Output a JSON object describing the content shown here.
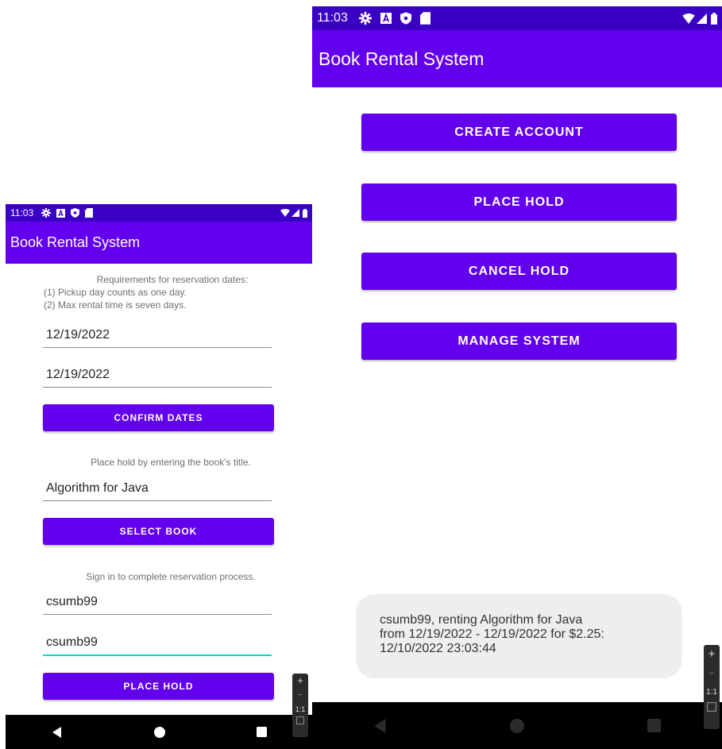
{
  "left": {
    "status_time": "11:03",
    "app_title": "Book Rental System",
    "requirements": {
      "title": "Requirements for reservation dates:",
      "rule1": "(1) Pickup day counts as one day.",
      "rule2": "(2) Max rental time is seven days."
    },
    "pickup_date": "12/19/2022",
    "return_date": "12/19/2022",
    "confirm_dates_label": "CONFIRM DATES",
    "title_hint": "Place hold by entering the book's title.",
    "book_title": "Algorithm for Java",
    "select_book_label": "SELECT BOOK",
    "signin_hint": "Sign in to complete reservation process.",
    "username": "csumb99",
    "password": "csumb99",
    "place_hold_label": "PLACE HOLD"
  },
  "right": {
    "status_time": "11:03",
    "app_title": "Book Rental System",
    "buttons": [
      "CREATE ACCOUNT",
      "PLACE HOLD",
      "CANCEL HOLD",
      "MANAGE SYSTEM"
    ],
    "toast": {
      "line1": "csumb99, renting Algorithm for Java",
      "line2": "from 12/19/2022 - 12/19/2022 for $2.25:",
      "line3": "12/10/2022 23:03:44"
    }
  },
  "zoom_controls": {
    "plus": "+",
    "minus": "−",
    "one_to_one": "1:1"
  },
  "colors": {
    "primary": "#6200ee",
    "status_bar": "#3a00c4",
    "accent": "#03dac5"
  }
}
